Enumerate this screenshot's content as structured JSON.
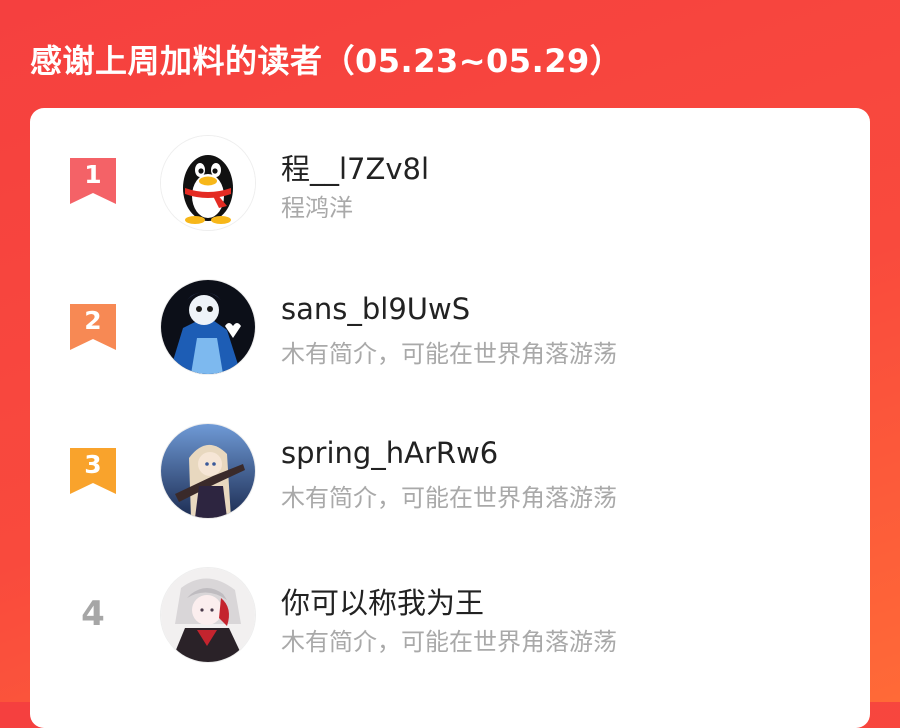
{
  "header": {
    "title": "感谢上周加料的读者（05.23~05.29）"
  },
  "colors": {
    "background_top": "#f5403f",
    "background_bottom": "#ff6a37",
    "rank1": "#f46267",
    "rank2": "#f78954",
    "rank3": "#f9a32c",
    "rank_plain": "#a6a6a6",
    "name_text": "#222222",
    "bio_text": "#a9a9a9"
  },
  "readers": [
    {
      "rank": "1",
      "name": "程__l7Zv8l",
      "bio": "程鸿洋",
      "avatar_icon": "qq-penguin-icon"
    },
    {
      "rank": "2",
      "name": "sans_bl9UwS",
      "bio": "木有简介，可能在世界角落游荡",
      "avatar_icon": "anime-character-avatar"
    },
    {
      "rank": "3",
      "name": "spring_hArRw6",
      "bio": "木有简介，可能在世界角落游荡",
      "avatar_icon": "anime-girl-avatar"
    },
    {
      "rank": "4",
      "name": "你可以称我为王",
      "bio": "木有简介，可能在世界角落游荡",
      "avatar_icon": "anime-boy-avatar"
    }
  ]
}
